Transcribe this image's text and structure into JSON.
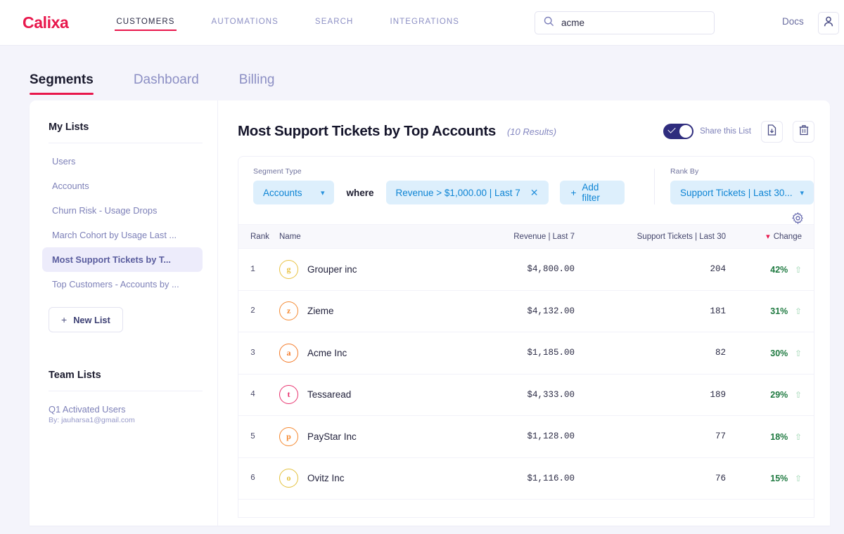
{
  "brand": "Calixa",
  "topnav": {
    "links": [
      {
        "label": "CUSTOMERS",
        "active": true
      },
      {
        "label": "AUTOMATIONS",
        "active": false
      },
      {
        "label": "SEARCH",
        "active": false
      },
      {
        "label": "INTEGRATIONS",
        "active": false
      }
    ],
    "search": {
      "value": "acme",
      "placeholder": "Search",
      "icon": "search-icon"
    },
    "docs_label": "Docs",
    "account_icon": "user-icon"
  },
  "subtabs": [
    {
      "label": "Segments",
      "active": true
    },
    {
      "label": "Dashboard",
      "active": false
    },
    {
      "label": "Billing",
      "active": false
    }
  ],
  "sidebar": {
    "my_lists_heading": "My Lists",
    "items": [
      {
        "label": "Users",
        "selected": false
      },
      {
        "label": "Accounts",
        "selected": false
      },
      {
        "label": "Churn Risk - Usage Drops",
        "selected": false
      },
      {
        "label": "March Cohort by Usage Last ...",
        "selected": false
      },
      {
        "label": "Most Support Tickets by T...",
        "selected": true
      },
      {
        "label": "Top Customers - Accounts by ...",
        "selected": false
      }
    ],
    "new_list_label": "New List",
    "new_list_plus": "+",
    "team_lists_heading": "Team Lists",
    "team_items": [
      {
        "name": "Q1 Activated Users",
        "by": "By: jauharsa1@gmail.com"
      }
    ]
  },
  "main": {
    "title": "Most Support Tickets by Top Accounts",
    "results": "(10 Results)",
    "share_toggle_on": true,
    "share_label": "Share this List",
    "export_icon": "download-file-icon",
    "delete_icon": "trash-icon",
    "settings_icon": "gear-icon",
    "filters": {
      "segment_type_label": "Segment Type",
      "segment_type_value": "Accounts",
      "where_label": "where",
      "filter_chips": [
        {
          "label": "Revenue > $1,000.00 | Last 7",
          "remove_icon": "close-icon"
        }
      ],
      "add_filter_label": "Add filter",
      "add_filter_plus": "+",
      "rank_by_label": "Rank By",
      "rank_by_value": "Support Tickets | Last 30...",
      "chevron_icon": "chevron-down-icon"
    }
  },
  "table": {
    "columns": [
      {
        "key": "rank",
        "label": "Rank"
      },
      {
        "key": "name",
        "label": "Name"
      },
      {
        "key": "revenue",
        "label": "Revenue | Last 7"
      },
      {
        "key": "tickets",
        "label": "Support Tickets | Last 30"
      },
      {
        "key": "change",
        "label": "Change",
        "sort": "desc",
        "sort_icon": "caret-down-icon"
      }
    ],
    "rows": [
      {
        "rank": "1",
        "initial": "g",
        "color": "#e8c242",
        "name": "Grouper inc",
        "revenue": "$4,800.00",
        "tickets": "204",
        "change": "42%",
        "trend": "up"
      },
      {
        "rank": "2",
        "initial": "z",
        "color": "#f58a33",
        "name": "Zieme",
        "revenue": "$4,132.00",
        "tickets": "181",
        "change": "31%",
        "trend": "up"
      },
      {
        "rank": "3",
        "initial": "a",
        "color": "#f47a28",
        "name": "Acme Inc",
        "revenue": "$1,185.00",
        "tickets": "82",
        "change": "30%",
        "trend": "up"
      },
      {
        "rank": "4",
        "initial": "t",
        "color": "#e8336f",
        "name": "Tessaread",
        "revenue": "$4,333.00",
        "tickets": "189",
        "change": "29%",
        "trend": "up"
      },
      {
        "rank": "5",
        "initial": "p",
        "color": "#f5882f",
        "name": "PayStar Inc",
        "revenue": "$1,128.00",
        "tickets": "77",
        "change": "18%",
        "trend": "up"
      },
      {
        "rank": "6",
        "initial": "o",
        "color": "#e4c13c",
        "name": "Ovitz Inc",
        "revenue": "$1,116.00",
        "tickets": "76",
        "change": "15%",
        "trend": "up"
      }
    ],
    "trend_up_glyph": "⇧"
  },
  "colors": {
    "brand_red": "#e8174c",
    "page_bg": "#f4f4fb",
    "pill_bg": "#ddeffc",
    "pill_text": "#0d84d4",
    "toggle_on": "#2f2d7e",
    "positive": "#1f7a41",
    "sidebar_selected_bg": "#edecfb"
  }
}
